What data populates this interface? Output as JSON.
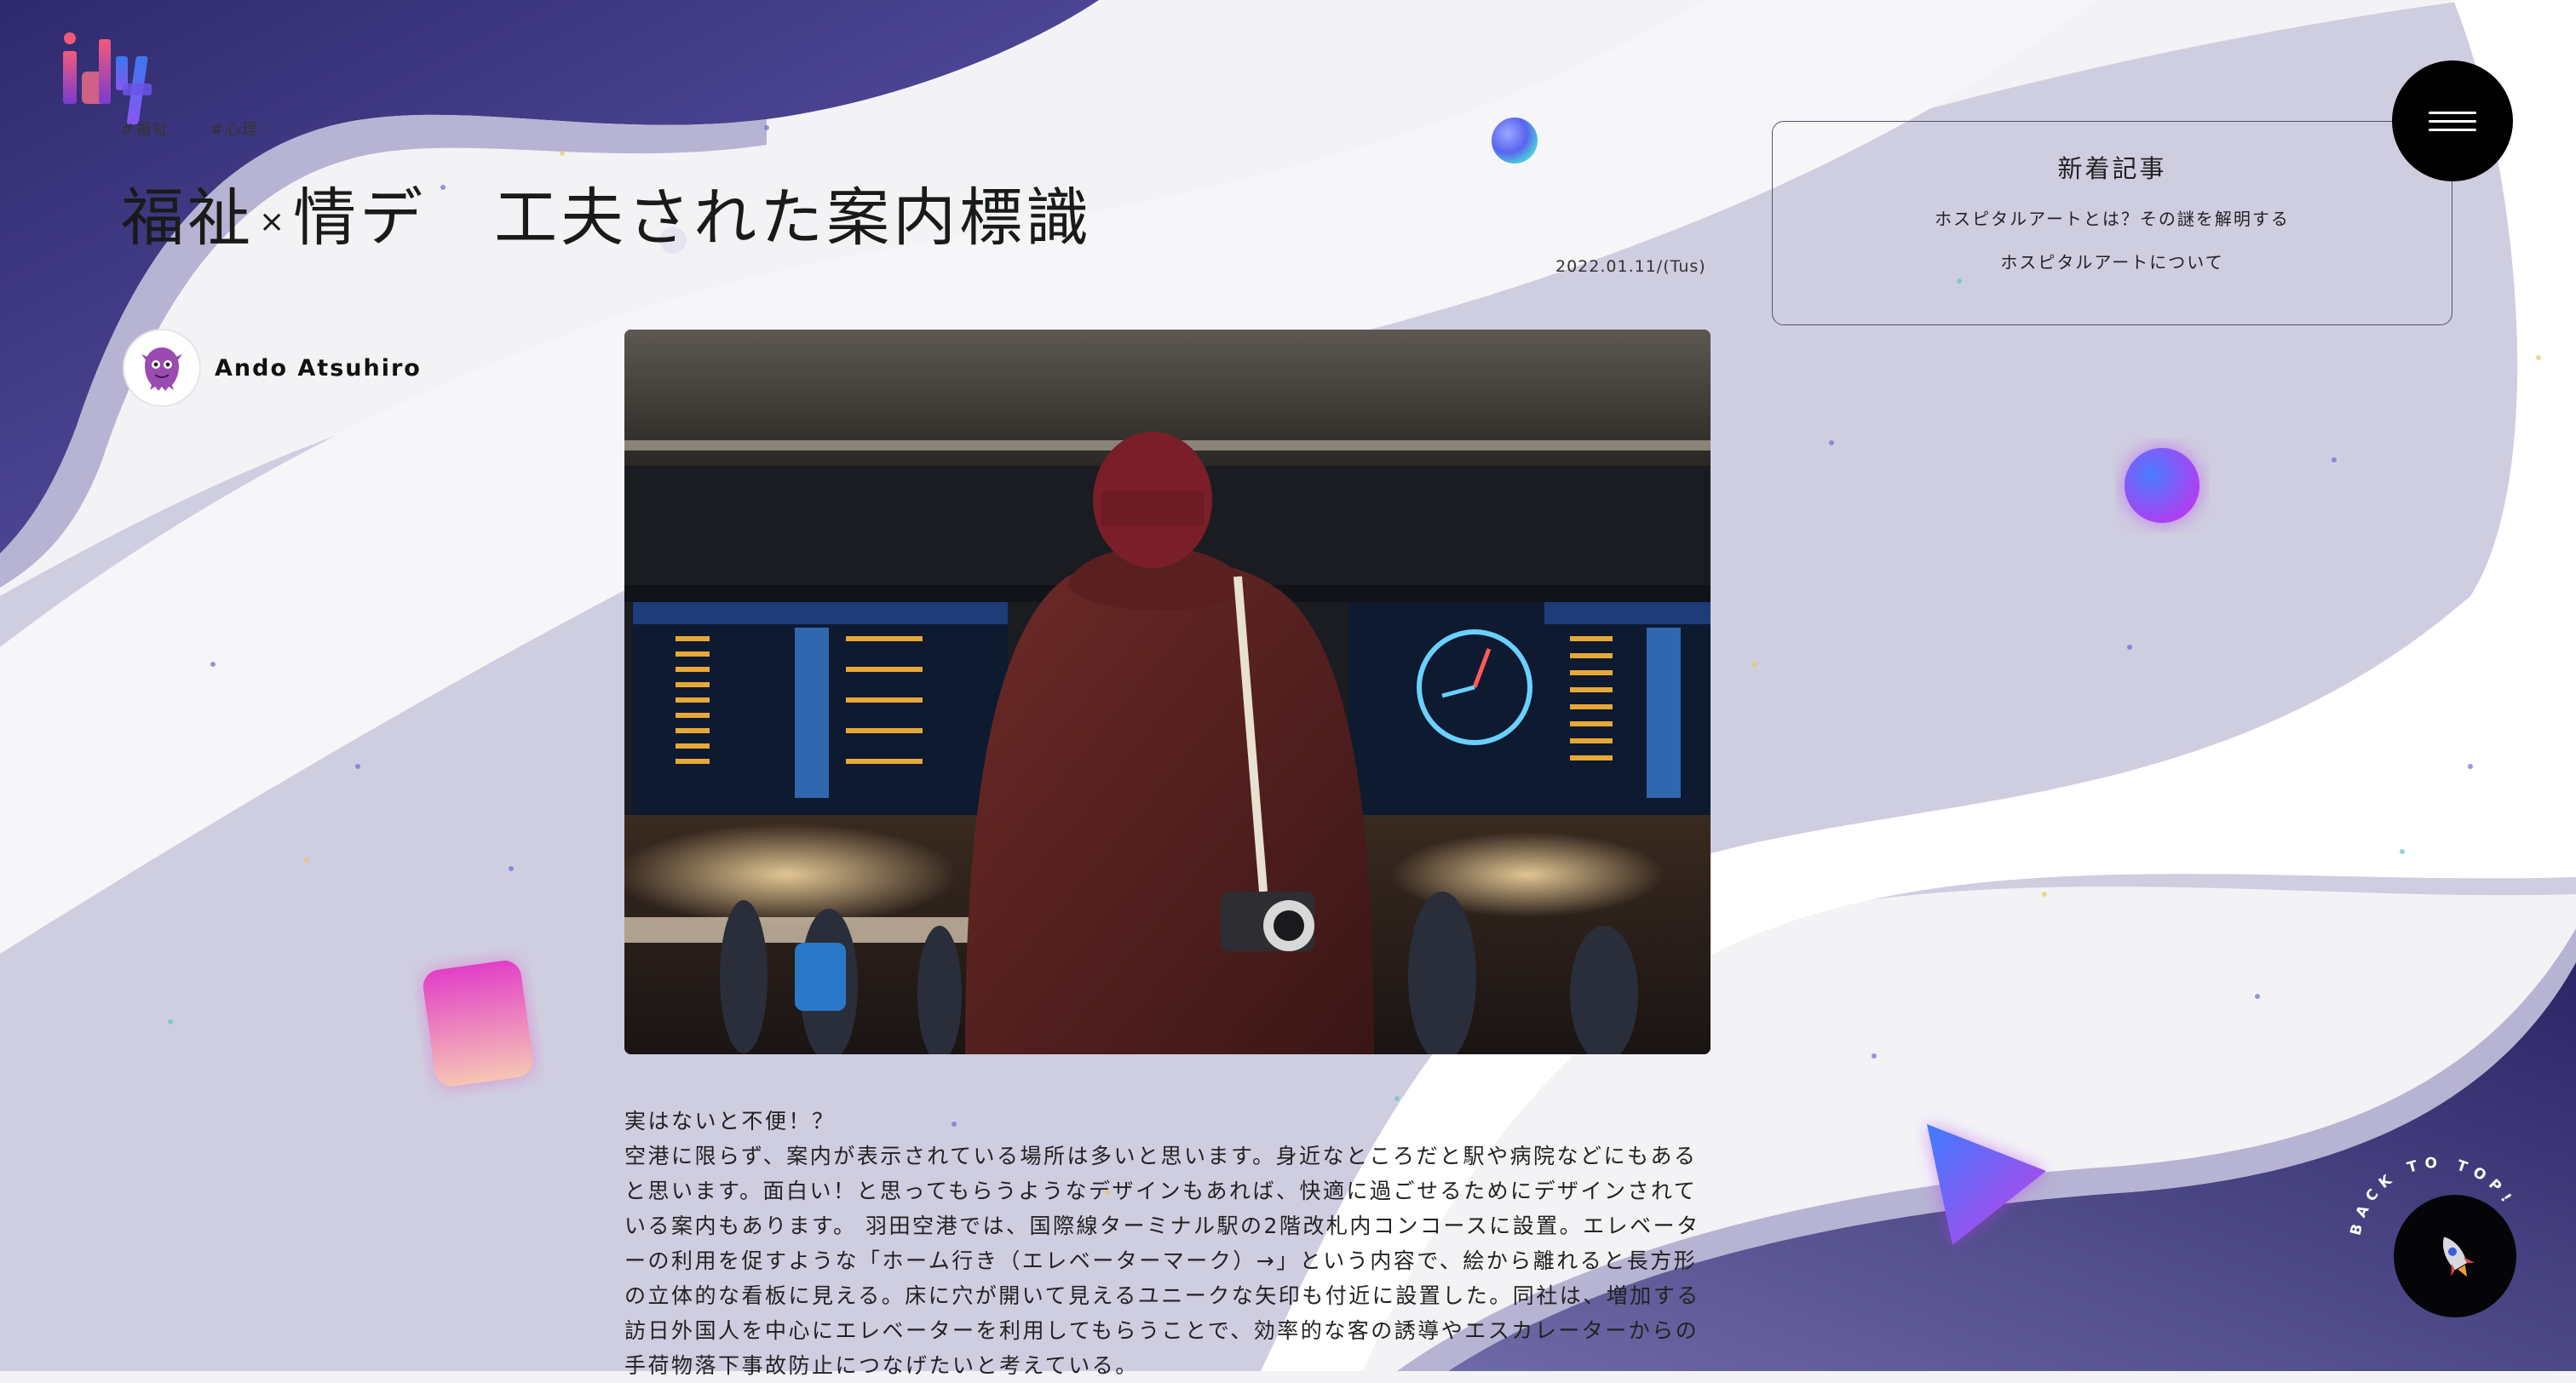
{
  "tags": [
    "#福祉",
    "#心理"
  ],
  "article_title": {
    "part1": "福祉",
    "times": "×",
    "part2": "情デ",
    "part3": "工夫された案内標識"
  },
  "date": "2022.01.11/(Tus)",
  "author": {
    "name": "Ando Atsuhiro",
    "avatar_icon": "monster-avatar-icon"
  },
  "hero_image": {
    "subject": "traveler with camera in front of airport departures board"
  },
  "article": {
    "heading": "実はないと不便！？",
    "body": "空港に限らず、案内が表示されている場所は多いと思います。身近なところだと駅や病院などにもあると思います。面白い！と思ってもらうようなデザインもあれば、快適に過ごせるためにデザインされている案内もあります。 羽田空港では、国際線ターミナル駅の2階改札内コンコースに設置。エレベーターの利用を促すような「ホーム行き（エレベーターマーク）→」という内容で、絵から離れると長方形の立体的な看板に見える。床に穴が開いて見えるユニークな矢印も付近に設置した。同社は、増加する訪日外国人を中心にエレベーターを利用してもらうことで、効率的な客の誘導やエスカレーターからの手荷物落下事故防止につなげたいと考えている。"
  },
  "news": {
    "title": "新着記事",
    "items": [
      "ホスピタルアートとは？その謎を解明する",
      "ホスピタルアートについて"
    ]
  },
  "back_to_top": {
    "label": "BACK TO TOP!",
    "icon": "rocket-icon"
  },
  "menu": {
    "icon": "hamburger-menu-icon"
  },
  "colors": {
    "brand_dark": "#3a2f7a",
    "wave_light": "#cfcddf",
    "accent_pink": "#e040b8",
    "accent_blue": "#5a5cf0"
  }
}
